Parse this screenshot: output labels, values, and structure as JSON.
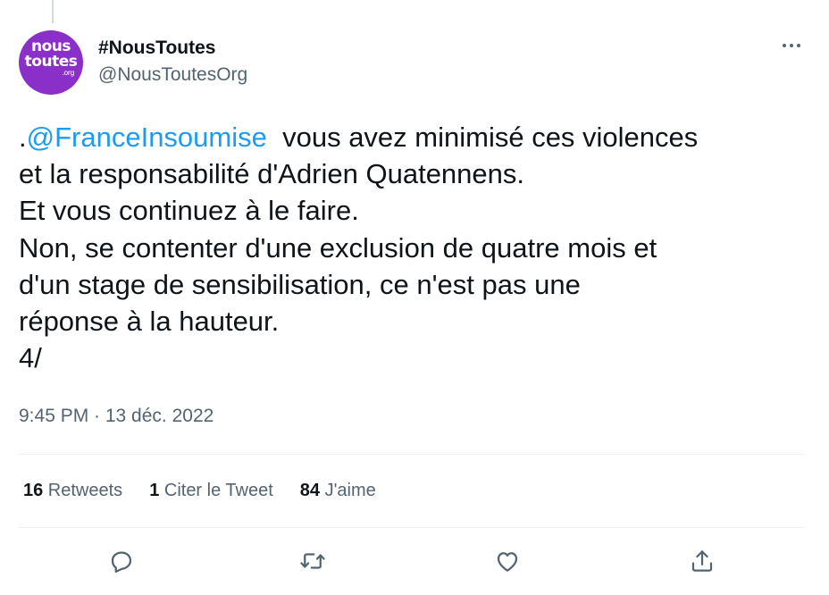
{
  "account": {
    "avatar": {
      "line1": "nous",
      "line2": "toutes",
      "line3": ".org",
      "color": "#8b2fc9"
    },
    "display_name": "#NousToutes",
    "handle": "@NousToutesOrg"
  },
  "menu": {
    "icon": "more-horizontal-icon"
  },
  "tweet": {
    "lines": [
      {
        "prefix": ".",
        "mention": "@FranceInsoumise",
        "text": "  vous avez minimisé ces violences"
      },
      {
        "text": "et la responsabilité d'Adrien Quatennens."
      },
      {
        "text": "Et vous continuez à le faire."
      },
      {
        "text": "Non, se contenter d'une exclusion de quatre mois et"
      },
      {
        "text": "d'un stage de sensibilisation, ce n'est pas une"
      },
      {
        "text": "réponse à la hauteur."
      },
      {
        "text": "4/"
      }
    ],
    "timestamp": "9:45 PM · 13 déc. 2022"
  },
  "stats": {
    "retweets_count": "16",
    "retweets_label": " Retweets",
    "quotes_count": "1",
    "quotes_label": " Citer le Tweet",
    "likes_count": "84",
    "likes_label": " J'aime"
  },
  "actions": [
    {
      "icon": "reply-icon"
    },
    {
      "icon": "retweet-icon"
    },
    {
      "icon": "like-icon"
    },
    {
      "icon": "share-icon"
    }
  ],
  "colors": {
    "text": "#0f1419",
    "secondary": "#536471",
    "mention": "#1d9bf0",
    "divider": "#eff3f4"
  }
}
